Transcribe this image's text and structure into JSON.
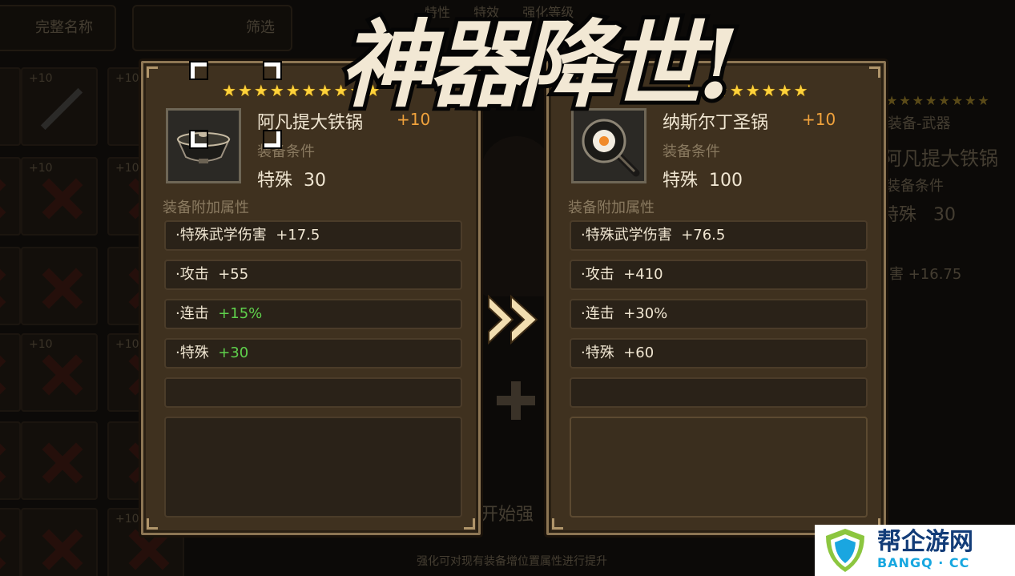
{
  "background": {
    "filter_name_label": "完整名称",
    "filter_button_label": "筛选",
    "top_tabs": [
      "特性",
      "特效",
      "强化等级"
    ],
    "slot_level": "+10",
    "side_panel": {
      "type_label": "装备-武器",
      "item_name": "阿凡提大铁锅",
      "req_label": "装备条件",
      "req_stat": "特殊",
      "req_value": "30",
      "stat_partial": "害 +16.75"
    },
    "start_button_label": "开始强",
    "footer_hint": "强化可对现有装备增位置属性进行提升"
  },
  "headline_text": "神器降世!",
  "left_item": {
    "name": "阿凡提大铁锅",
    "level": "+10",
    "stars": 10,
    "icon": "iron-wok-icon",
    "requirement_label": "装备条件",
    "requirement_stat": "特殊",
    "requirement_value": "30",
    "bonus_title": "装备附加属性",
    "stats": [
      {
        "name": "·特殊武学伤害",
        "value": "+17.5",
        "highlight": false
      },
      {
        "name": "·攻击",
        "value": "+55",
        "highlight": false
      },
      {
        "name": "·连击",
        "value": "+15%",
        "highlight": true
      },
      {
        "name": "·特殊",
        "value": "+30",
        "highlight": true
      }
    ]
  },
  "right_item": {
    "name": "纳斯尔丁圣锅",
    "level": "+10",
    "stars": 8,
    "icon": "holy-frying-pan-icon",
    "requirement_label": "装备条件",
    "requirement_stat": "特殊",
    "requirement_value": "100",
    "bonus_title": "装备附加属性",
    "stats": [
      {
        "name": "·特殊武学伤害",
        "value": "+76.5",
        "highlight": false
      },
      {
        "name": "·攻击",
        "value": "+410",
        "highlight": false
      },
      {
        "name": "·连击",
        "value": "+30%",
        "highlight": false
      },
      {
        "name": "·特殊",
        "value": "+60",
        "highlight": false
      }
    ]
  },
  "colors": {
    "star": "#ffd23a",
    "level": "#f0a23c",
    "highlight_value": "#5fd14c",
    "card_bg": "#3f311f"
  },
  "watermark": {
    "title": "帮企游网",
    "url": "BANGQ · CC"
  }
}
